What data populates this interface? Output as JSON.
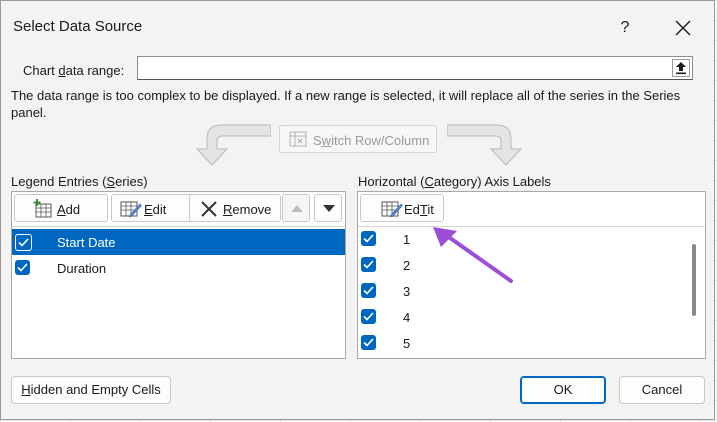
{
  "dialog": {
    "title": "Select Data Source",
    "help": "?",
    "close": "close"
  },
  "chart_range": {
    "label_pre": "Chart ",
    "label_key": "d",
    "label_post": "ata range:",
    "value": ""
  },
  "warning": "The data range is too complex to be displayed. If a new range is selected, it will replace all of the series in the Series panel.",
  "switch_button": {
    "pre": "S",
    "key": "w",
    "post": "itch Row/Column"
  },
  "legend": {
    "label_pre": "Legend Entries (",
    "label_key": "S",
    "label_post": "eries)",
    "add": {
      "key": "A",
      "post": "dd"
    },
    "edit": {
      "key": "E",
      "post": "dit"
    },
    "remove": {
      "key": "R",
      "post": "emove"
    },
    "items": [
      {
        "label": "Start Date",
        "checked": true,
        "selected": true
      },
      {
        "label": "Duration",
        "checked": true,
        "selected": false
      }
    ]
  },
  "axis": {
    "label_pre": "Horizontal (",
    "label_key": "C",
    "label_post": "ategory) Axis Labels",
    "edit": {
      "key": "T",
      "pre": "Ed",
      "post": "it"
    },
    "items": [
      {
        "label": "1",
        "checked": true
      },
      {
        "label": "2",
        "checked": true
      },
      {
        "label": "3",
        "checked": true
      },
      {
        "label": "4",
        "checked": true
      },
      {
        "label": "5",
        "checked": true
      }
    ]
  },
  "footer": {
    "hidden_pre": "",
    "hidden_key": "H",
    "hidden_post": "idden and Empty Cells",
    "ok": "OK",
    "cancel": "Cancel"
  },
  "colors": {
    "accent": "#0067c0",
    "annotation_arrow": "#9b4fd9"
  },
  "icons": [
    "close-icon",
    "collapse-range-icon",
    "switch-row-column-icon",
    "add-icon",
    "edit-icon",
    "remove-icon",
    "move-up-icon",
    "move-down-icon",
    "checkbox-checked-icon"
  ]
}
